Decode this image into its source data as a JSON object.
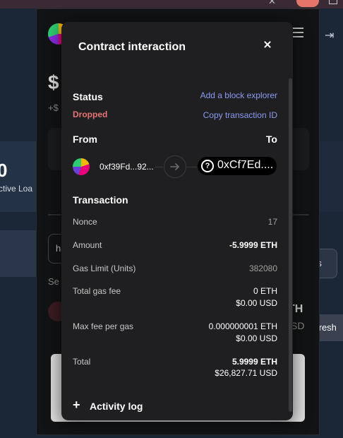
{
  "background": {
    "left_balance": "0",
    "left_label": "ctive Loa",
    "right_button": "rs",
    "refresh_label": "fresh",
    "balance_symbol": "$",
    "balance_sub": "+$",
    "search_text": "ha",
    "search_hint": "Se",
    "right_eth": "TH",
    "right_usd": "SD"
  },
  "modal": {
    "title": "Contract interaction",
    "status": {
      "label": "Status",
      "value": "Dropped",
      "add_explorer": "Add a block explorer",
      "copy_tx": "Copy transaction ID"
    },
    "from": {
      "label": "From",
      "address": "0xf39Fd...92..."
    },
    "to": {
      "label": "To",
      "address": "0xCf7Ed...."
    },
    "transaction": {
      "heading": "Transaction",
      "rows": [
        {
          "label": "Nonce",
          "value": "17"
        },
        {
          "label": "Amount",
          "value": "-5.9999 ETH"
        },
        {
          "label": "Gas Limit (Units)",
          "value": "382080"
        },
        {
          "label": "Total gas fee",
          "value": "0 ETH",
          "value2": "$0.00 USD"
        },
        {
          "label": "Max fee per gas",
          "value": "0.000000001 ETH",
          "value2": "$0.00 USD"
        },
        {
          "label": "Total",
          "value": "5.9999 ETH",
          "value2": "$26,827.71 USD"
        }
      ]
    },
    "activity_log": "Activity log"
  }
}
